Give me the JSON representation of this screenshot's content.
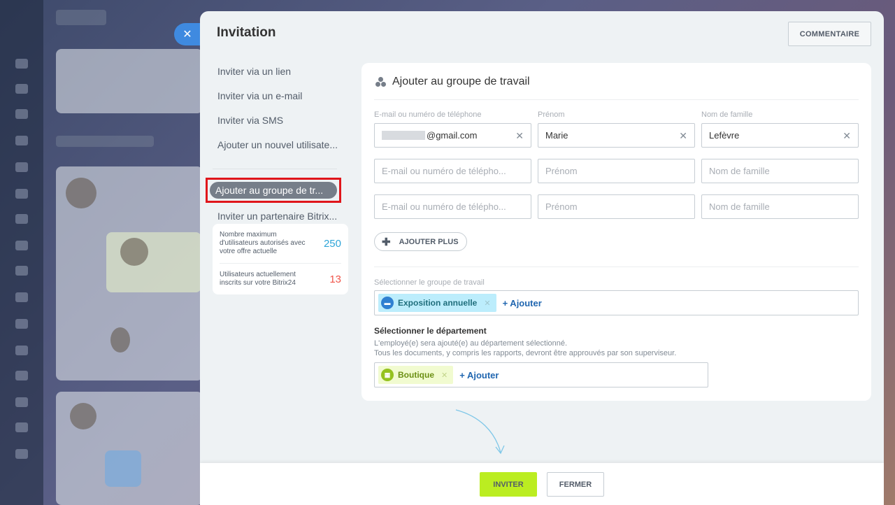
{
  "slider": {
    "title": "Invitation",
    "comment_button": "COMMENTAIRE"
  },
  "menu": {
    "items": [
      "Inviter via un lien",
      "Inviter via un e-mail",
      "Inviter via SMS",
      "Ajouter un nouvel utilisate..."
    ],
    "active": "Ajouter au groupe de tr...",
    "partner": "Inviter un partenaire Bitrix..."
  },
  "stats": {
    "max_label": "Nombre maximum d'utilisateurs autorisés avec votre offre actuelle",
    "max_value": "250",
    "current_label": "Utilisateurs actuellement inscrits sur votre Bitrix24",
    "current_value": "13",
    "max_color": "#2fa5d8",
    "current_color": "#f0554a"
  },
  "form": {
    "title": "Ajouter au groupe de travail",
    "label_email": "E-mail ou numéro de téléphone",
    "label_first": "Prénom",
    "label_last": "Nom de famille",
    "row1": {
      "email": "@gmail.com",
      "first": "Marie",
      "last": "Lefèvre"
    },
    "placeholder_email": "E-mail ou numéro de télépho...",
    "placeholder_first": "Prénom",
    "placeholder_last": "Nom de famille",
    "add_more": "AJOUTER PLUS",
    "group_label": "Sélectionner le groupe de travail",
    "group_tag": "Exposition annuelle",
    "add_link": "+ Ajouter",
    "dept_title": "Sélectionner le département",
    "dept_desc1": "L'employé(e) sera ajouté(e) au département sélectionné.",
    "dept_desc2": "Tous les documents, y compris les rapports, devront être approuvés par son superviseur.",
    "dept_tag": "Boutique"
  },
  "footer": {
    "invite": "INVITER",
    "close": "FERMER"
  },
  "colors": {
    "accent_blue": "#3f8ae0",
    "invite_green": "#bbed21",
    "highlight_red": "#e0161b"
  }
}
